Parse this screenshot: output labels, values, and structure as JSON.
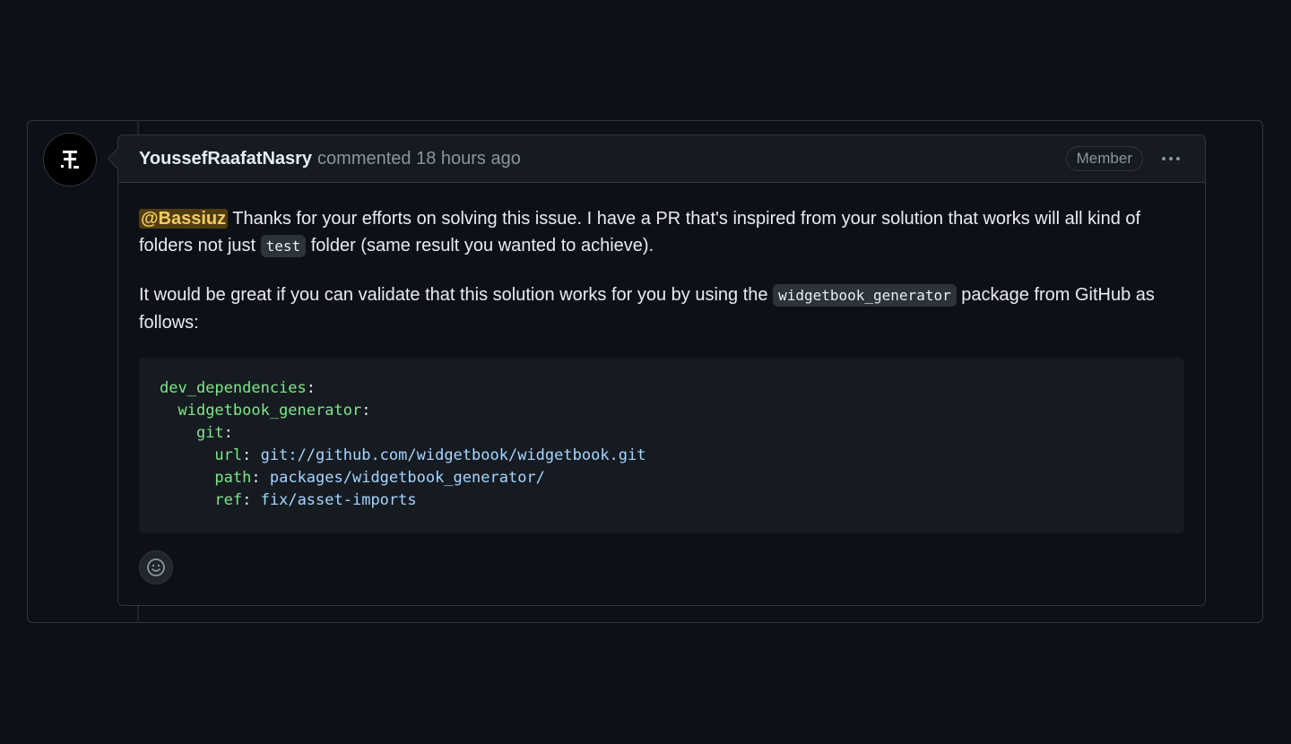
{
  "comment": {
    "author": "YoussefRaafatNasry",
    "meta": "commented 18 hours ago",
    "badge": "Member",
    "mention": "@Bassiuz",
    "para1_a": " Thanks for your efforts on solving this issue. I have a PR that's inspired from your solution that works will all kind of folders not just ",
    "para1_code": "test",
    "para1_b": " folder (same result you wanted to achieve).",
    "para2_a": "It would be great if you can validate that this solution works for you by using the ",
    "para2_code": "widgetbook_generator",
    "para2_b": " package from GitHub as follows:",
    "code_lines": [
      {
        "indent": "",
        "key": "dev_dependencies",
        "value": ""
      },
      {
        "indent": "  ",
        "key": "widgetbook_generator",
        "value": ""
      },
      {
        "indent": "    ",
        "key": "git",
        "value": ""
      },
      {
        "indent": "      ",
        "key": "url",
        "value": "git://github.com/widgetbook/widgetbook.git"
      },
      {
        "indent": "      ",
        "key": "path",
        "value": "packages/widgetbook_generator/"
      },
      {
        "indent": "      ",
        "key": "ref",
        "value": "fix/asset-imports"
      }
    ]
  },
  "icons": {
    "avatar": "avatar-logo-icon",
    "menu": "kebab-menu-icon",
    "reaction": "smiley-icon"
  },
  "colors": {
    "background": "#0d1117",
    "header": "#161b22",
    "border": "#30363d",
    "mention": "#f2cc60",
    "code_key": "#7ee787",
    "code_value": "#a5d6ff"
  }
}
